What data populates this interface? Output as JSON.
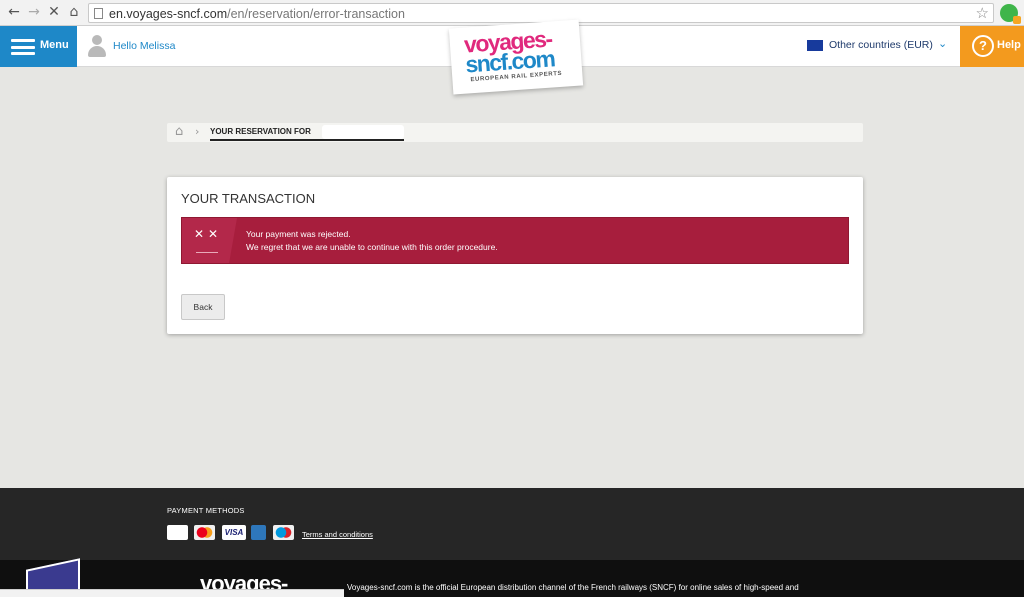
{
  "browser": {
    "url_host": "en.voyages-sncf.com",
    "url_path": "/en/reservation/error-transaction"
  },
  "header": {
    "menu_label": "Menu",
    "greeting": "Hello Melissa",
    "logo_line1": "voyages-",
    "logo_line2": "sncf.com",
    "logo_tagline": "EUROPEAN RAIL EXPERTS",
    "country": "Other countries (EUR)",
    "help_label": "Help"
  },
  "breadcrumb": {
    "current": "YOUR RESERVATION FOR"
  },
  "transaction": {
    "title": "YOUR TRANSACTION",
    "error_line1": "Your payment was rejected.",
    "error_line2": "We regret that we are unable to continue with this order procedure.",
    "back_label": "Back"
  },
  "footer": {
    "payment_title": "PAYMENT METHODS",
    "payment_methods": [
      "CB",
      "Mastercard",
      "VISA",
      "American Express",
      "Maestro"
    ],
    "terms_label": "Terms and conditions",
    "bottom_logo": "voyages-",
    "description": "Voyages-sncf.com is the official European distribution channel of the French railways (SNCF) for online sales of high-speed and"
  },
  "colors": {
    "menu_blue": "#1e88c8",
    "help_orange": "#f39a1e",
    "alert_red": "#a71e3d",
    "logo_pink": "#e0297d"
  }
}
